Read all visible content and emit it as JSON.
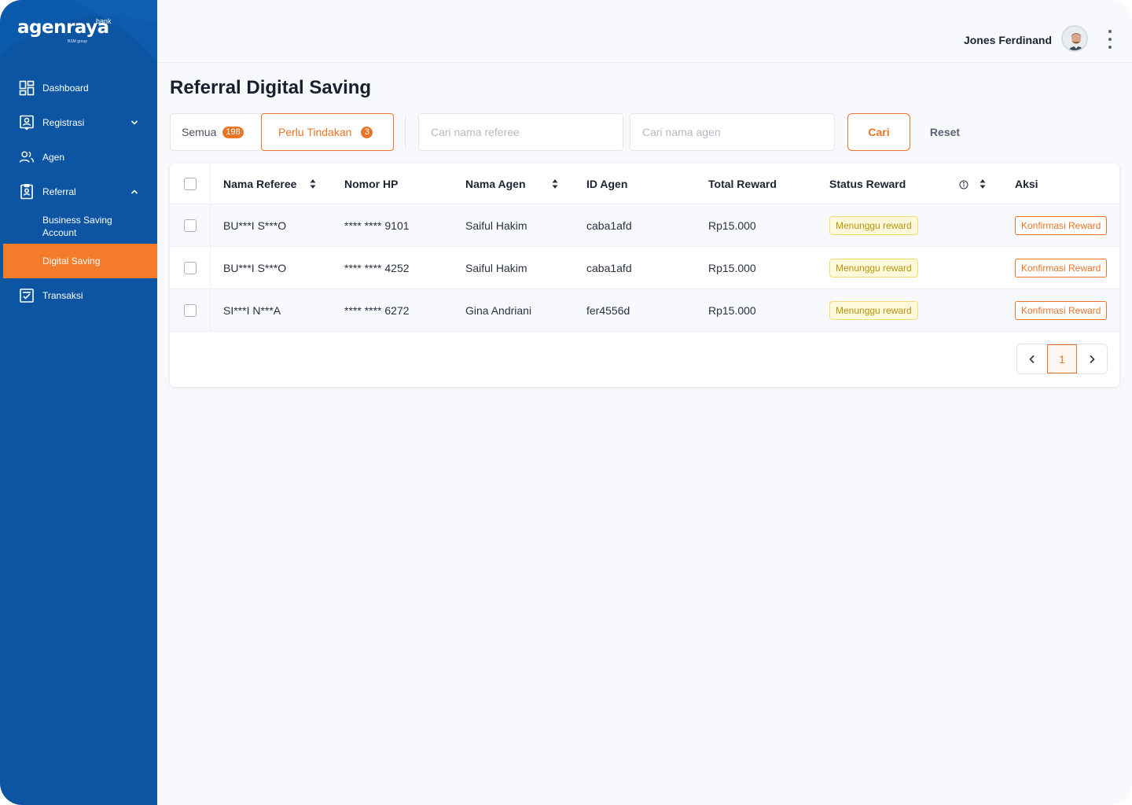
{
  "brand": {
    "name": "agenraya",
    "sup": "bank",
    "sub": "BSM group"
  },
  "colors": {
    "sidebar": "#0b55a3",
    "accent": "#e8752a",
    "active_nav": "#f47b2a",
    "status_bg": "#fff9db",
    "status_text": "#b8930b"
  },
  "sidebar": {
    "items": [
      {
        "label": "Dashboard",
        "icon": "dashboard-icon"
      },
      {
        "label": "Registrasi",
        "icon": "registration-icon",
        "expand": "chevron-down-icon"
      },
      {
        "label": "Agen",
        "icon": "users-icon"
      },
      {
        "label": "Referral",
        "icon": "referral-icon",
        "expand": "chevron-up-icon"
      },
      {
        "label": "Transaksi",
        "icon": "transaction-icon"
      }
    ],
    "referral_sub": [
      {
        "label_line1": "Business Saving",
        "label_line2": "Account"
      },
      {
        "label": "Digital Saving",
        "active": true
      }
    ]
  },
  "header": {
    "user_name": "Jones Ferdinand",
    "avatar": "avatar",
    "menu_icon": "kebab-menu-icon"
  },
  "page": {
    "title": "Referral Digital Saving"
  },
  "filters": {
    "tabs": [
      {
        "label": "Semua",
        "count": "198"
      },
      {
        "label": "Perlu Tindakan",
        "count": "3"
      }
    ],
    "search_referee_placeholder": "Cari nama referee",
    "search_agent_placeholder": "Cari nama agen",
    "search_button": "Cari",
    "reset_button": "Reset"
  },
  "table": {
    "columns": [
      "Nama Referee",
      "Nomor HP",
      "Nama Agen",
      "ID Agen",
      "Total Reward",
      "Status Reward",
      "Aksi"
    ],
    "rows": [
      {
        "referee": "BU***I S***O",
        "phone": "**** **** 9101",
        "agent": "Saiful Hakim",
        "agent_id": "caba1afd",
        "reward": "Rp15.000",
        "status": "Menunggu reward",
        "action": "Konfirmasi Reward"
      },
      {
        "referee": "BU***I S***O",
        "phone": "**** **** 4252",
        "agent": "Saiful Hakim",
        "agent_id": "caba1afd",
        "reward": "Rp15.000",
        "status": "Menunggu reward",
        "action": "Konfirmasi Reward"
      },
      {
        "referee": "SI***I N***A",
        "phone": "**** **** 6272",
        "agent": "Gina Andriani",
        "agent_id": "fer4556d",
        "reward": "Rp15.000",
        "status": "Menunggu reward",
        "action": "Konfirmasi Reward"
      }
    ]
  },
  "pagination": {
    "current": "1",
    "prev_icon": "chevron-left-icon",
    "next_icon": "chevron-right-icon"
  }
}
